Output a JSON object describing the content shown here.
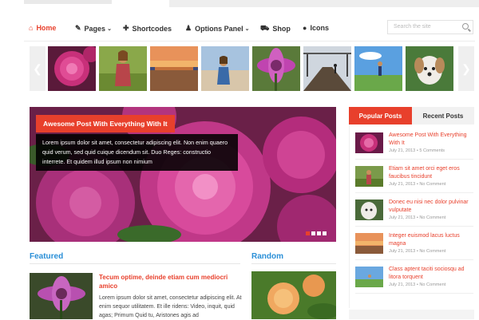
{
  "nav": {
    "items": [
      {
        "label": "Home",
        "icon": "home-icon",
        "active": true
      },
      {
        "label": "Pages",
        "icon": "pencil-icon",
        "dropdown": true
      },
      {
        "label": "Shortcodes",
        "icon": "plus-icon"
      },
      {
        "label": "Options Panel",
        "icon": "user-icon",
        "dropdown": true
      },
      {
        "label": "Shop",
        "icon": "cart-icon"
      },
      {
        "label": "Icons",
        "icon": "apple-icon"
      }
    ],
    "search_placeholder": "Search the site"
  },
  "colors": {
    "accent": "#e8402c",
    "section_title": "#2a8fd7"
  },
  "carousel": {
    "thumbs": [
      "pink-dahlia",
      "woman-in-field",
      "sunset-harbor",
      "woman-on-beach",
      "purple-flower",
      "pier-walkway",
      "hiker-on-hill",
      "dog-in-grass"
    ]
  },
  "featured_slider": {
    "title": "Awesome Post With Everything With It",
    "excerpt": "Lorem ipsum dolor sit amet, consectetur adipiscing elit. Non enim quaero quid verum, sed quid cuique dicendum sit. Duo Reges: constructio interrete. Et quidem illud ipsum non nimium",
    "slides": 4,
    "active_slide": 1
  },
  "featured": {
    "heading": "Featured",
    "post": {
      "title": "Tecum optime, deinde etiam cum mediocri amico",
      "excerpt": "Lorem ipsum dolor sit amet, consectetur adipiscing elit. At enim sequor utilitatem. Et ille ridens: Video, inquit, quid agas; Primum Quid tu, Aristones agis ad"
    }
  },
  "random": {
    "heading": "Random"
  },
  "sidebar": {
    "tabs": [
      {
        "label": "Popular Posts",
        "active": true
      },
      {
        "label": "Recent Posts",
        "active": false
      }
    ],
    "posts": [
      {
        "title": "Awesome Post With Everything With It",
        "meta": "July 21, 2013 • 5 Comments"
      },
      {
        "title": "Etiam sit amet orci eget eros faucibus tincidunt",
        "meta": "July 21, 2013 • No Comment"
      },
      {
        "title": "Donec eu nisi nec dolor pulvinar vulputate",
        "meta": "July 21, 2013 • No Comment"
      },
      {
        "title": "Integer euismod lacus luctus magna",
        "meta": "July 21, 2013 • No Comment"
      },
      {
        "title": "Class aptent taciti sociosqu ad litora torquent",
        "meta": "July 21, 2013 • No Comment"
      }
    ]
  }
}
